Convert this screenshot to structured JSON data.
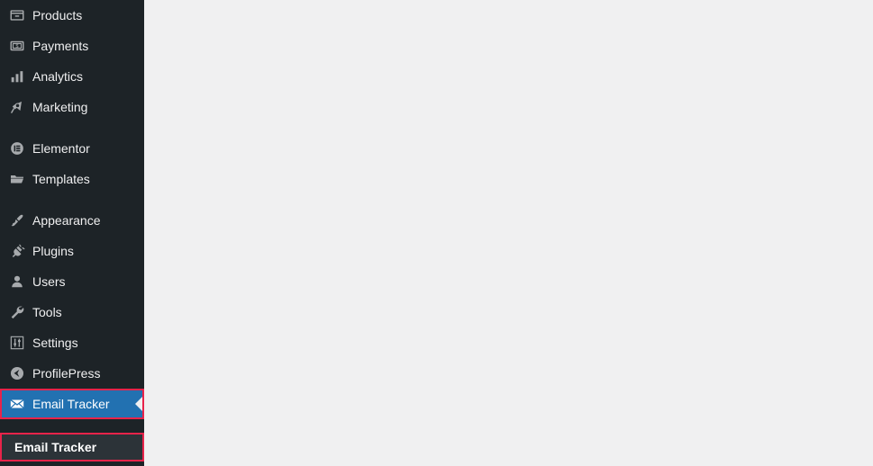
{
  "colors": {
    "sidebar_bg": "#1d2327",
    "submenu_bg": "#2c3338",
    "active_bg": "#2271b1",
    "highlight_border": "#e8234a",
    "icon": "#a7aaad",
    "text": "#f0f0f1",
    "content_bg": "#f0f0f1"
  },
  "sidebar": {
    "items": [
      {
        "label": "Products",
        "icon": "products-icon",
        "group": 1,
        "state": "normal"
      },
      {
        "label": "Payments",
        "icon": "payments-icon",
        "group": 1,
        "state": "normal"
      },
      {
        "label": "Analytics",
        "icon": "analytics-icon",
        "group": 1,
        "state": "normal"
      },
      {
        "label": "Marketing",
        "icon": "megaphone-icon",
        "group": 1,
        "state": "normal"
      },
      {
        "label": "Elementor",
        "icon": "elementor-icon",
        "group": 2,
        "state": "normal"
      },
      {
        "label": "Templates",
        "icon": "folder-icon",
        "group": 2,
        "state": "normal"
      },
      {
        "label": "Appearance",
        "icon": "paintbrush-icon",
        "group": 3,
        "state": "normal"
      },
      {
        "label": "Plugins",
        "icon": "plug-icon",
        "group": 3,
        "state": "normal"
      },
      {
        "label": "Users",
        "icon": "user-icon",
        "group": 3,
        "state": "normal"
      },
      {
        "label": "Tools",
        "icon": "wrench-icon",
        "group": 3,
        "state": "normal"
      },
      {
        "label": "Settings",
        "icon": "sliders-icon",
        "group": 3,
        "state": "normal"
      },
      {
        "label": "ProfilePress",
        "icon": "profilepress-icon",
        "group": 3,
        "state": "normal"
      },
      {
        "label": "Email Tracker",
        "icon": "envelope-icon",
        "group": 3,
        "state": "current"
      }
    ],
    "submenu": {
      "parent": "Email Tracker",
      "items": [
        {
          "label": "Email Tracker"
        }
      ]
    }
  }
}
